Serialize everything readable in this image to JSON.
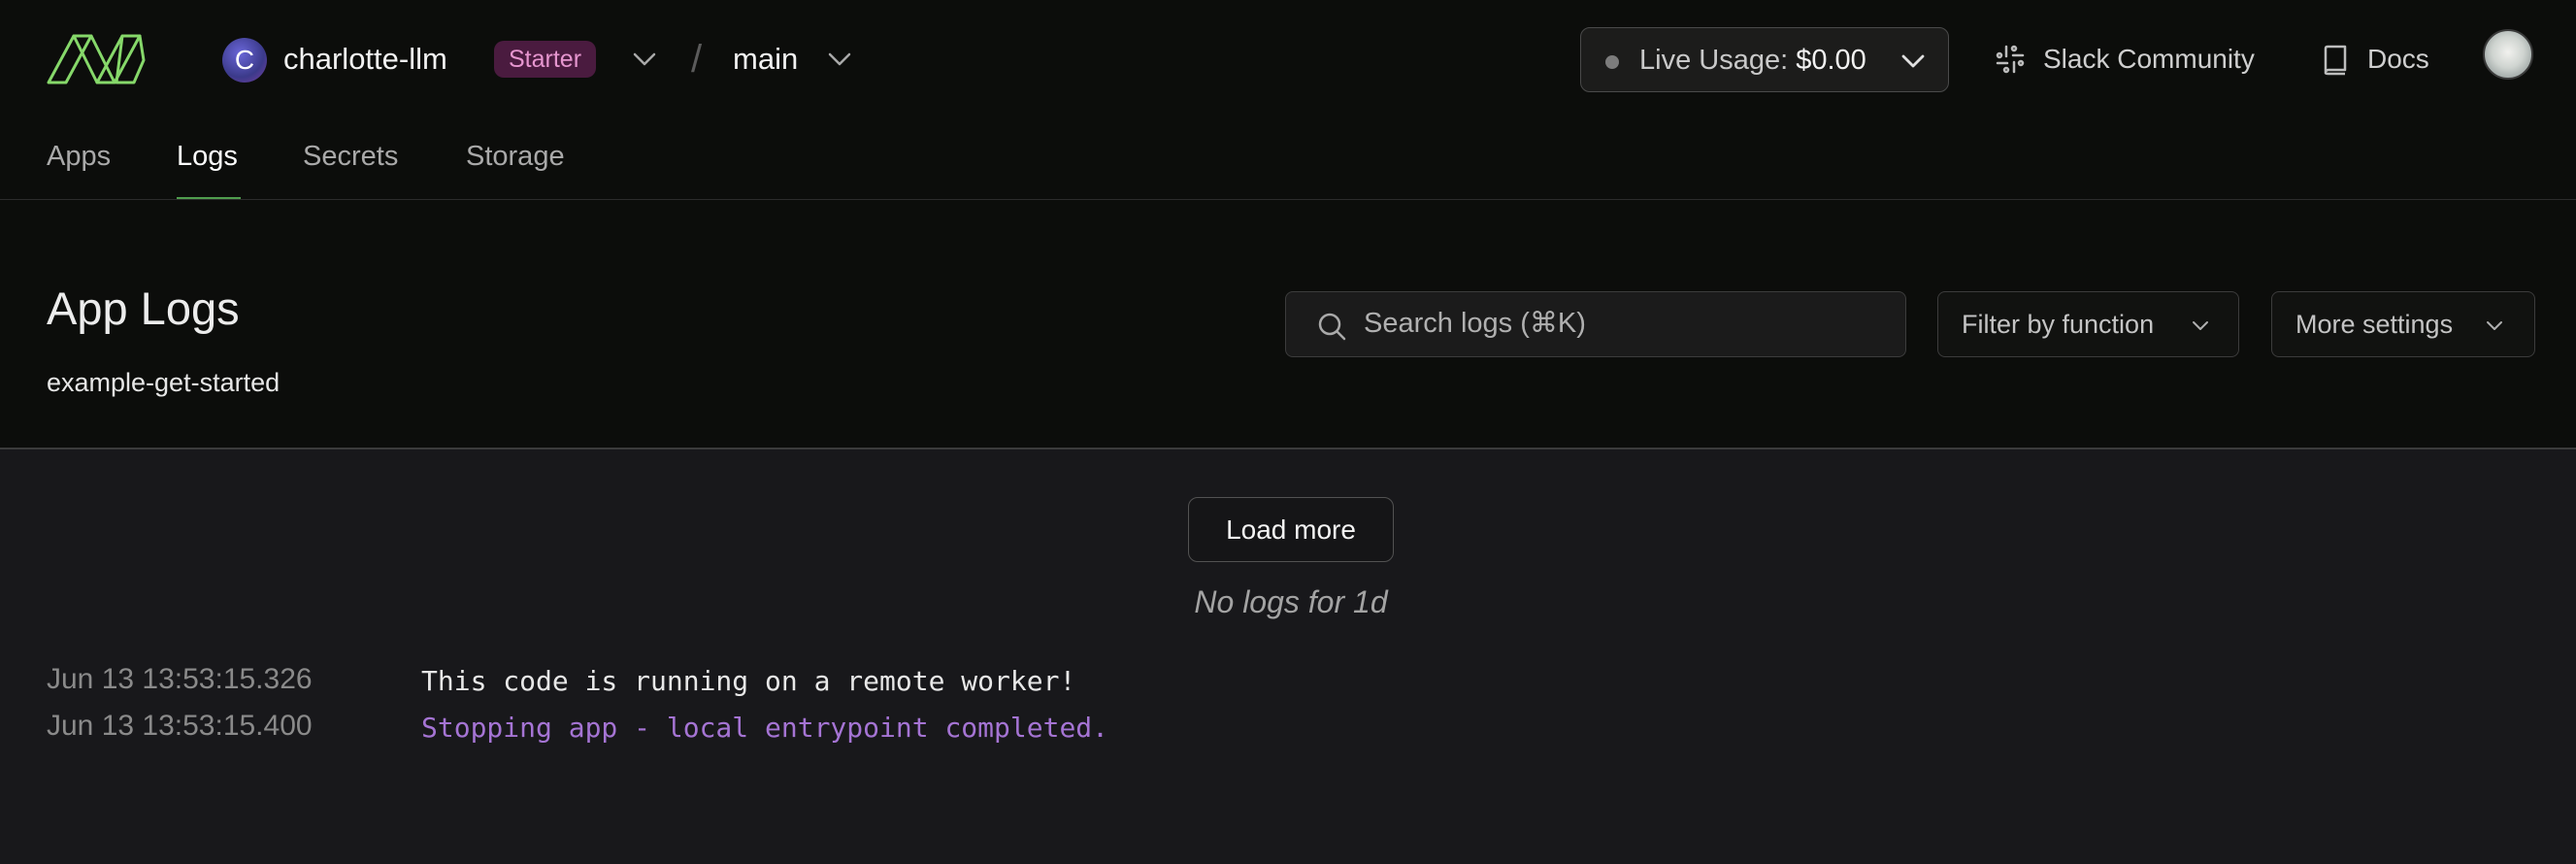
{
  "header": {
    "org": {
      "avatar_letter": "C",
      "name": "charlotte-llm",
      "plan": "Starter"
    },
    "separator": "/",
    "environment": "main",
    "usage": {
      "label": "Live Usage:",
      "value": "$0.00"
    },
    "links": {
      "slack": "Slack Community",
      "docs": "Docs"
    }
  },
  "tabs": [
    {
      "label": "Apps",
      "active": false
    },
    {
      "label": "Logs",
      "active": true
    },
    {
      "label": "Secrets",
      "active": false
    },
    {
      "label": "Storage",
      "active": false
    }
  ],
  "page": {
    "title": "App Logs",
    "app_name": "example-get-started",
    "search": {
      "placeholder": "Search logs (⌘K)",
      "value": ""
    },
    "filter_label": "Filter by function",
    "settings_label": "More settings"
  },
  "logs": {
    "load_more_label": "Load more",
    "empty_notice": "No logs for 1d",
    "entries": [
      {
        "timestamp": "Jun 13  13:53:15.326",
        "message": "This code is running on a remote worker!",
        "color": "#e8e8e8"
      },
      {
        "timestamp": "Jun 13  13:53:15.400",
        "message": "Stopping app - local entrypoint completed.",
        "color": "#a574d4"
      }
    ]
  },
  "icons": {
    "logo": "modal-logo-icon",
    "org_dropdown": "chevron-down-icon",
    "env_dropdown": "chevron-down-icon",
    "usage_status": "status-dot-icon",
    "slack": "slack-icon",
    "docs": "book-icon",
    "search": "search-icon"
  },
  "colors": {
    "accent": "#4f9d4d",
    "logo": "#86d86a",
    "badge_bg": "#4a1b3f",
    "badge_text": "#e696cf",
    "system_log": "#a574d4"
  }
}
